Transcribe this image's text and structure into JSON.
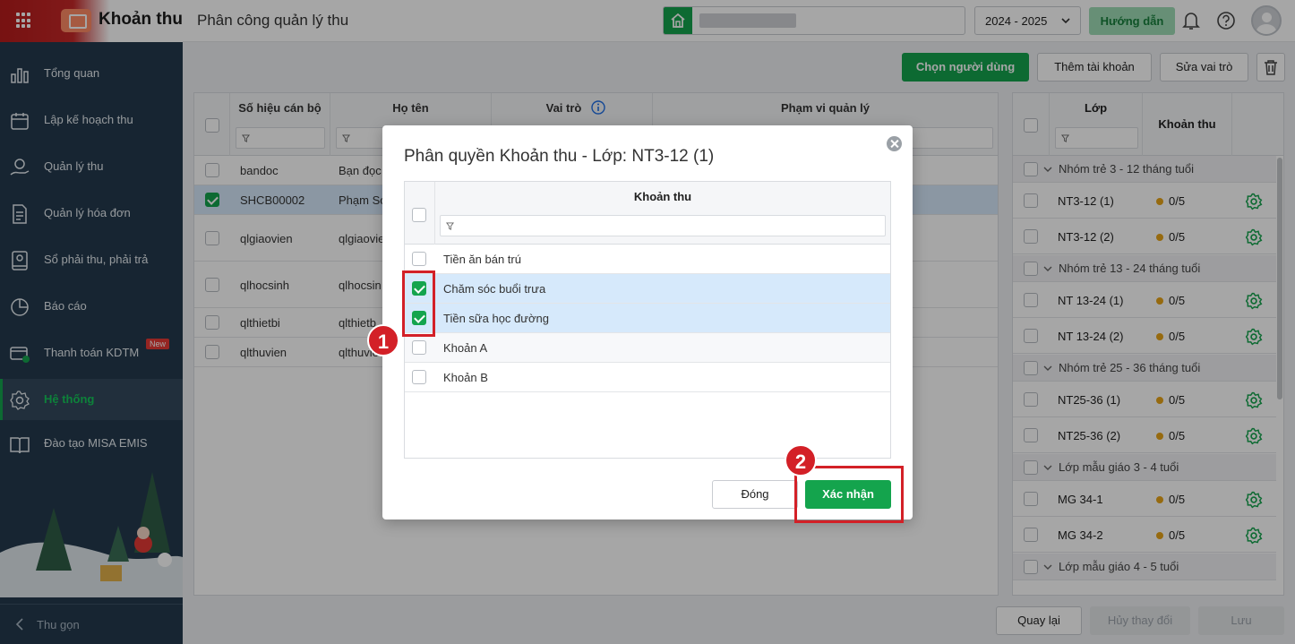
{
  "header": {
    "app_title": "Khoản thu",
    "page_title": "Phân công quản lý thu",
    "school_year": "2024 - 2025",
    "guide_label": "Hướng dẫn"
  },
  "sidebar": {
    "items": [
      {
        "label": "Tổng quan",
        "icon": "chart-icon"
      },
      {
        "label": "Lập kế hoạch thu",
        "icon": "calendar-icon"
      },
      {
        "label": "Quản lý thu",
        "icon": "money-hand-icon"
      },
      {
        "label": "Quản lý hóa đơn",
        "icon": "invoice-icon"
      },
      {
        "label": "Sổ phải thu, phải trả",
        "icon": "ledger-icon"
      },
      {
        "label": "Báo cáo",
        "icon": "pie-chart-icon"
      },
      {
        "label": "Thanh toán KDTM",
        "icon": "payment-icon"
      },
      {
        "label": "Hệ thống",
        "icon": "gear-icon"
      },
      {
        "label": "Đào tạo MISA EMIS",
        "icon": "book-icon"
      }
    ],
    "new_badge": "New",
    "collapse_label": "Thu gọn"
  },
  "toolbar": {
    "choose_user": "Chọn người dùng",
    "add_account": "Thêm tài khoản",
    "edit_role": "Sửa vai trò"
  },
  "table": {
    "columns": [
      "Số hiệu cán bộ",
      "Họ tên",
      "Vai trò",
      "Phạm vi quản lý"
    ],
    "rows": [
      {
        "code": "bandoc",
        "name": "Bạn đọc",
        "checked": false
      },
      {
        "code": "SHCB00002",
        "name": "Phạm Sơ",
        "checked": true
      },
      {
        "code": "qlgiaovien",
        "name": "qlgiaovie",
        "checked": false
      },
      {
        "code": "qlhocsinh",
        "name": "qlhocsin",
        "checked": false
      },
      {
        "code": "qlthietbi",
        "name": "qlthietb",
        "checked": false
      },
      {
        "code": "qlthuvien",
        "name": "qlthuvie",
        "checked": false
      }
    ]
  },
  "right_panel": {
    "columns": [
      "Lớp",
      "Khoản thu"
    ],
    "groups": [
      {
        "name": "Nhóm trẻ 3 - 12 tháng tuổi",
        "classes": [
          {
            "name": "NT3-12 (1)",
            "count": "0/5"
          },
          {
            "name": "NT3-12 (2)",
            "count": "0/5"
          }
        ]
      },
      {
        "name": "Nhóm trẻ 13 - 24 tháng tuổi",
        "classes": [
          {
            "name": "NT 13-24 (1)",
            "count": "0/5"
          },
          {
            "name": "NT 13-24 (2)",
            "count": "0/5"
          }
        ]
      },
      {
        "name": "Nhóm trẻ 25 - 36 tháng tuổi",
        "classes": [
          {
            "name": "NT25-36 (1)",
            "count": "0/5"
          },
          {
            "name": "NT25-36 (2)",
            "count": "0/5"
          }
        ]
      },
      {
        "name": "Lớp mẫu giáo 3 - 4 tuổi",
        "classes": [
          {
            "name": "MG 34-1",
            "count": "0/5"
          },
          {
            "name": "MG 34-2",
            "count": "0/5"
          }
        ]
      },
      {
        "name": "Lớp mẫu giáo 4 - 5 tuổi",
        "classes": []
      }
    ]
  },
  "footer": {
    "back": "Quay lại",
    "cancel_changes": "Hủy thay đổi",
    "save": "Lưu"
  },
  "modal": {
    "title": "Phân quyền Khoản thu - Lớp: NT3-12 (1)",
    "column": "Khoản thu",
    "items": [
      {
        "label": "Tiền ăn bán trú",
        "checked": false
      },
      {
        "label": "Chăm sóc buổi trưa",
        "checked": true
      },
      {
        "label": "Tiền sữa học đường",
        "checked": true
      },
      {
        "label": "Khoản A",
        "checked": false
      },
      {
        "label": "Khoản B",
        "checked": false
      }
    ],
    "close_label": "Đóng",
    "confirm_label": "Xác nhận"
  },
  "annotations": {
    "marker1": "1",
    "marker2": "2"
  },
  "colors": {
    "accent": "#14a44d",
    "sidebar": "#243a4d",
    "highlight": "#d32027",
    "selected_row": "#d6e9fb"
  }
}
